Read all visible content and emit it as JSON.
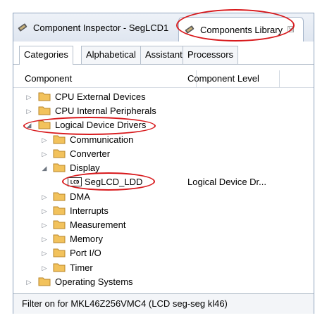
{
  "tabs": {
    "inspector_label": "Component Inspector - SegLCD1",
    "library_label": "Components Library",
    "close_glyph": "☒"
  },
  "subtabs": [
    "Categories",
    "Alphabetical",
    "Assistant",
    "Processors"
  ],
  "columns": {
    "component": "Component",
    "level": "Component Level"
  },
  "tree": {
    "cpu_external": "CPU External Devices",
    "cpu_internal": "CPU Internal Peripherals",
    "logical_drivers": "Logical Device Drivers",
    "communication": "Communication",
    "converter": "Converter",
    "display": "Display",
    "seglcd": "SegLCD_LDD",
    "seglcd_level": "Logical Device Dr...",
    "dma": "DMA",
    "interrupts": "Interrupts",
    "measurement": "Measurement",
    "memory": "Memory",
    "port_io": "Port I/O",
    "timer": "Timer",
    "operating_systems": "Operating Systems",
    "lcd_icon_text": "LCD"
  },
  "footer": {
    "filter_text": "Filter on for MKL46Z256VMC4 (LCD seg-seg kl46)"
  },
  "colors": {
    "highlight": "#d8191c",
    "folder": "#f2c25c",
    "tabbar": "#dfe6f0"
  }
}
